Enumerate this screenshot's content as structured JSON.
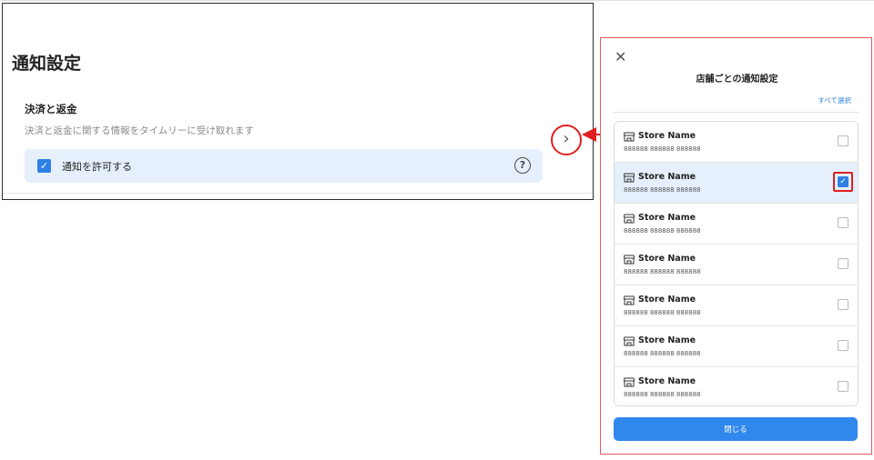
{
  "settings": {
    "page_title": "通知設定",
    "section_title": "決済と返金",
    "section_description": "決済と返金に関する情報をタイムリーに受け取れます",
    "allow_label": "通知を許可する",
    "allow_checked": true,
    "help_icon": "question-circle-icon",
    "chevron_icon": "chevron-right-icon"
  },
  "modal": {
    "title": "店舗ごとの通知設定",
    "select_all": "すべて選択",
    "close_button": "閉じる",
    "close_icon": "close-icon",
    "stores": [
      {
        "name": "Store Name",
        "code": "888888 888888 888888",
        "checked": false
      },
      {
        "name": "Store Name",
        "code": "888888 888888 888888",
        "checked": true
      },
      {
        "name": "Store Name",
        "code": "888888 888888 888888",
        "checked": false
      },
      {
        "name": "Store Name",
        "code": "888888 888888 888888",
        "checked": false
      },
      {
        "name": "Store Name",
        "code": "888888 888888 888888",
        "checked": false
      },
      {
        "name": "Store Name",
        "code": "888888 888888 888888",
        "checked": false
      },
      {
        "name": "Store Name",
        "code": "888888 888888 888888",
        "checked": false
      }
    ]
  },
  "colors": {
    "accent": "#2f80e4",
    "callout": "#e02020",
    "selected_row": "#e5f0fc"
  }
}
